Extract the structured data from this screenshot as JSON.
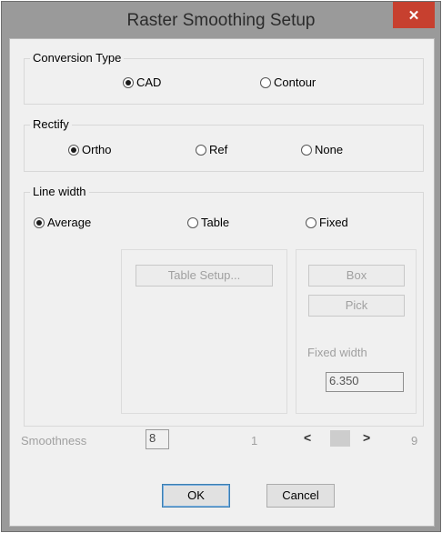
{
  "window": {
    "title": "Raster Smoothing Setup",
    "close_glyph": "✕"
  },
  "conversion_type": {
    "label": "Conversion Type",
    "options": [
      {
        "label": "CAD",
        "selected": true
      },
      {
        "label": "Contour",
        "selected": false
      }
    ]
  },
  "rectify": {
    "label": "Rectify",
    "options": [
      {
        "label": "Ortho",
        "selected": true
      },
      {
        "label": "Ref",
        "selected": false
      },
      {
        "label": "None",
        "selected": false
      }
    ]
  },
  "line_width": {
    "label": "Line width",
    "options": [
      {
        "label": "Average",
        "selected": true
      },
      {
        "label": "Table",
        "selected": false
      },
      {
        "label": "Fixed",
        "selected": false
      }
    ],
    "table_setup_label": "Table Setup...",
    "box_label": "Box",
    "pick_label": "Pick",
    "fixed_width_label": "Fixed width",
    "fixed_width_value": "6.350"
  },
  "smoothness": {
    "label": "Smoothness",
    "value": "8",
    "min": "1",
    "max": "9",
    "left_arrow": "<",
    "right_arrow": ">",
    "level": 8
  },
  "footer": {
    "ok_label": "OK",
    "cancel_label": "Cancel"
  }
}
